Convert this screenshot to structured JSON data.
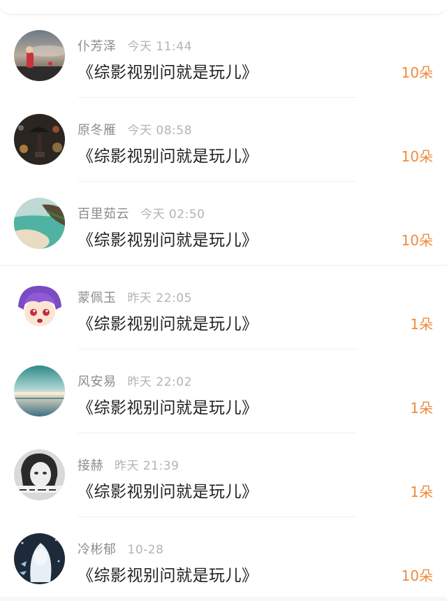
{
  "records": [
    {
      "name": "仆芳泽",
      "time": "今天 11:44",
      "gift": "《综影视别问就是玩儿》",
      "amount": "10朵",
      "avatar": "avatar-girl-balloon"
    },
    {
      "name": "原冬雁",
      "time": "今天 08:58",
      "gift": "《综影视别问就是玩儿》",
      "amount": "10朵",
      "avatar": "avatar-umbrella-night"
    },
    {
      "name": "百里茹云",
      "time": "今天 02:50",
      "gift": "《综影视别问就是玩儿》",
      "amount": "10朵",
      "avatar": "avatar-beach-cliff"
    },
    {
      "name": "蒙佩玉",
      "time": "昨天 22:05",
      "gift": "《综影视别问就是玩儿》",
      "amount": "1朵",
      "avatar": "avatar-anime-purple-hair"
    },
    {
      "name": "风安易",
      "time": "昨天 22:02",
      "gift": "《综影视别问就是玩儿》",
      "amount": "1朵",
      "avatar": "avatar-sea-horizon"
    },
    {
      "name": "接赫",
      "time": "昨天 21:39",
      "gift": "《综影视别问就是玩儿》",
      "amount": "1朵",
      "avatar": "avatar-girl-bw"
    },
    {
      "name": "冷彬郁",
      "time": "10-28",
      "gift": "《综影视别问就是玩儿》",
      "amount": "10朵",
      "avatar": "avatar-white-hair-anime"
    }
  ],
  "colors": {
    "amount": "#f08a3c",
    "name": "#8c8c8c",
    "time": "#b3b3b3",
    "gift": "#222222"
  }
}
